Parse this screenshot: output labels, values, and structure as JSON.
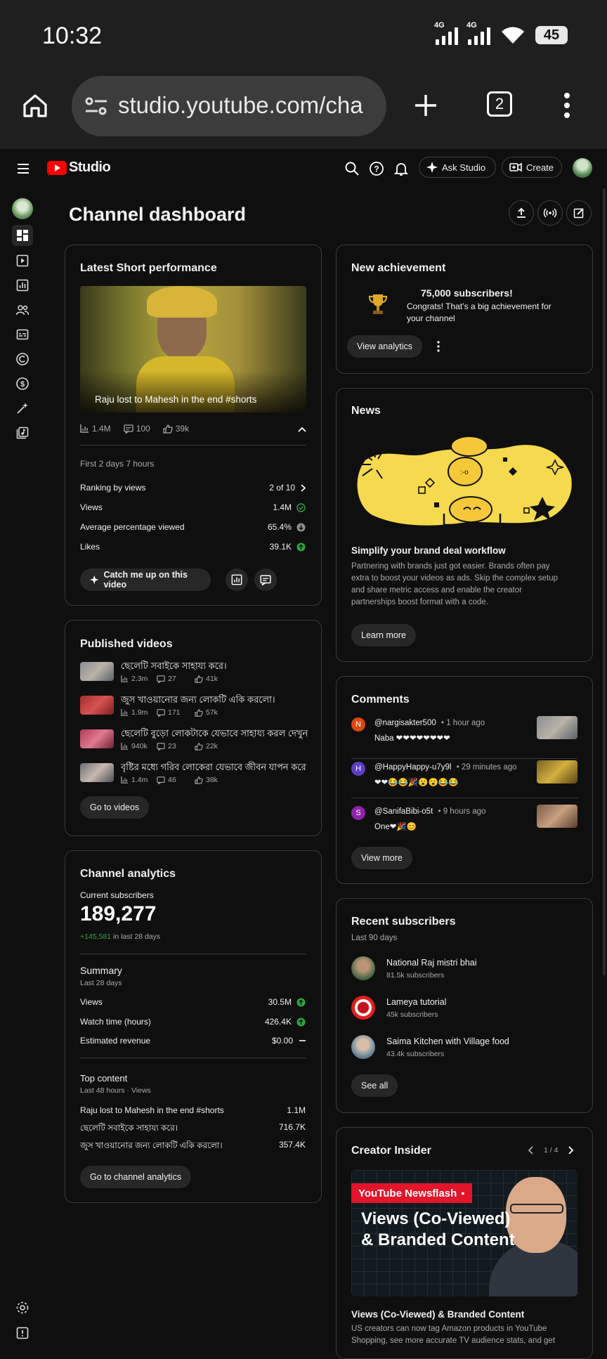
{
  "status_bar": {
    "time": "10:32",
    "net1": "4G",
    "net2": "4G",
    "battery": "45"
  },
  "browser": {
    "url": "studio.youtube.com/cha",
    "tab_count": "2"
  },
  "header": {
    "logo_text": "Studio",
    "ask_studio": "Ask Studio",
    "create": "Create"
  },
  "page": {
    "title": "Channel dashboard"
  },
  "latest_short": {
    "title": "Latest Short performance",
    "video_title": "Raju lost to Mahesh in the end #shorts",
    "views": "1.4M",
    "comments": "100",
    "likes": "39k",
    "period": "First 2 days 7 hours",
    "rows": [
      {
        "label": "Ranking by views",
        "value": "2 of 10"
      },
      {
        "label": "Views",
        "value": "1.4M"
      },
      {
        "label": "Average percentage viewed",
        "value": "65.4%"
      },
      {
        "label": "Likes",
        "value": "39.1K"
      }
    ],
    "catch_up": "Catch me up on this video"
  },
  "published": {
    "title": "Published videos",
    "videos": [
      {
        "title": "ছেলেটি সবাইকে সাহায্য করে।",
        "views": "2.3m",
        "comments": "27",
        "likes": "41k"
      },
      {
        "title": "জুস খাওয়ানোর জন্য লোকটি একি করলো।",
        "views": "1.9m",
        "comments": "171",
        "likes": "57k"
      },
      {
        "title": "ছেলেটি বুড়ো লোকটাকে যেভাবে সাহায্য করল দেখুন",
        "views": "940k",
        "comments": "23",
        "likes": "22k"
      },
      {
        "title": "বৃষ্টির মধ্যে গরিব লোকেরা যেভাবে জীবন যাপন করে",
        "views": "1.4m",
        "comments": "46",
        "likes": "38k"
      }
    ],
    "button": "Go to videos"
  },
  "analytics": {
    "title": "Channel analytics",
    "current_label": "Current subscribers",
    "subscribers": "189,277",
    "delta": "+145,581",
    "delta_suffix": "in last 28 days",
    "summary_title": "Summary",
    "summary_period": "Last 28 days",
    "summary": [
      {
        "label": "Views",
        "value": "30.5M"
      },
      {
        "label": "Watch time (hours)",
        "value": "426.4K"
      },
      {
        "label": "Estimated revenue",
        "value": "$0.00"
      }
    ],
    "top_title": "Top content",
    "top_period": "Last 48 hours · Views",
    "top": [
      {
        "label": "Raju lost to Mahesh in the end #shorts",
        "value": "1.1M"
      },
      {
        "label": "ছেলেটি সবাইকে সাহায্য করে।",
        "value": "716.7K"
      },
      {
        "label": "জুস খাওয়ানোর জন্য লোকটি একি করলো।",
        "value": "357.4K"
      }
    ],
    "button": "Go to channel analytics"
  },
  "achievement": {
    "title": "New achievement",
    "headline": "75,000 subscribers!",
    "line1": "Congrats! That’s a big achievement for",
    "line2": "your channel",
    "button": "View analytics"
  },
  "news": {
    "title": "News",
    "headline": "Simplify your brand deal workflow",
    "body": [
      "Partnering with brands just got easier. Brands often pay",
      "extra to boost your videos as ads. Skip the complex setup",
      "and share metric access and enable the creator",
      "partnerships boost format with a code."
    ],
    "button": "Learn more"
  },
  "comments": {
    "title": "Comments",
    "items": [
      {
        "initial": "N",
        "user": "@nargisakter500",
        "time": "1 hour ago",
        "text": "Naba ❤❤❤❤❤❤❤❤",
        "color": "#d9480f"
      },
      {
        "initial": "H",
        "user": "@HappyHappy-u7y9l",
        "time": "29 minutes ago",
        "text": "❤❤😂😂🎉😮😮😂😂",
        "color": "#5c3ec2"
      },
      {
        "initial": "S",
        "user": "@SanifaBibi-o5t",
        "time": "9 hours ago",
        "text": "One❤🎉😊",
        "color": "#8e24aa"
      }
    ],
    "button": "View more"
  },
  "recent_subs": {
    "title": "Recent subscribers",
    "period": "Last 90 days",
    "items": [
      {
        "name": "National Raj mistri bhai",
        "subs": "81.5k subscribers"
      },
      {
        "name": "Lameya tutorial",
        "subs": "45k subscribers"
      },
      {
        "name": "Saima Kitchen with Village food",
        "subs": "43.4k subscribers"
      }
    ],
    "button": "See all"
  },
  "insider": {
    "title": "Creator Insider",
    "pager": "1 / 4",
    "banner_tag": "YouTube Newsflash",
    "banner_line1": "Views (Co-Viewed)",
    "banner_line2": "& Branded Content",
    "video_title": "Views (Co-Viewed) & Branded Content",
    "body1": "US creators can now tag Amazon products in YouTube",
    "body2": "Shopping, see more accurate TV audience stats, and get"
  },
  "colors": {
    "accent_red": "#ff0000",
    "success_green": "#2ba640",
    "news_yellow": "#f5d94e"
  }
}
